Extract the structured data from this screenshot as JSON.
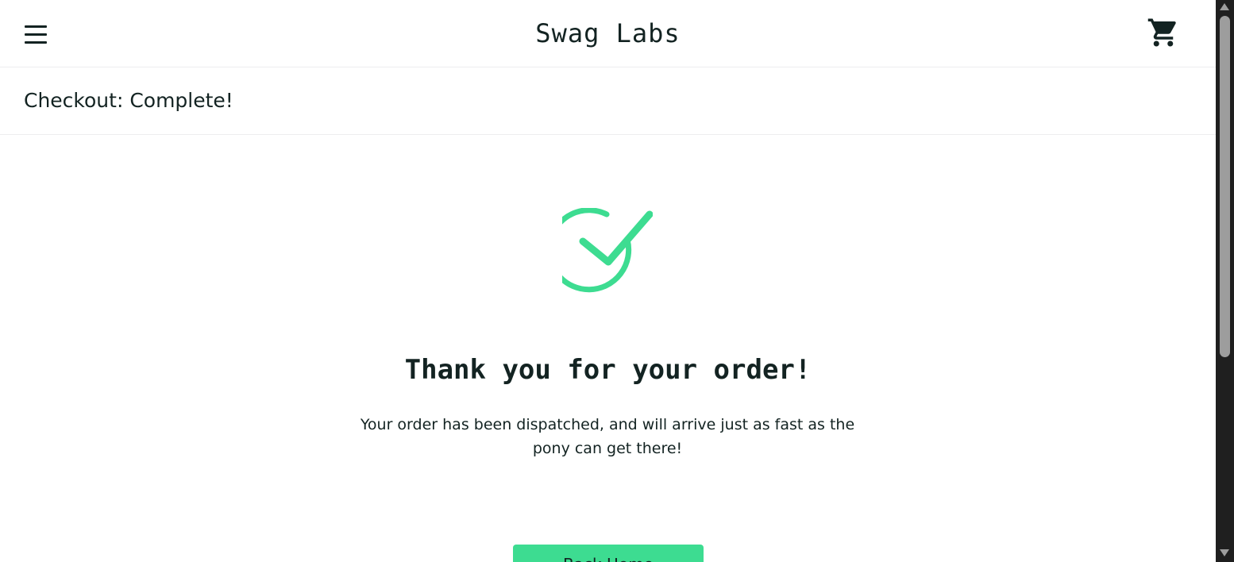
{
  "header": {
    "logo": "Swag Labs",
    "menu_icon": "hamburger-menu-icon",
    "cart_icon": "shopping-cart-icon"
  },
  "secondary_header": {
    "title": "Checkout: Complete!"
  },
  "complete": {
    "icon": "check-circle-icon",
    "heading": "Thank you for your order!",
    "message": "Your order has been dispatched, and will arrive just as fast as the pony can get there!",
    "back_home_label": "Back Home"
  },
  "colors": {
    "accent": "#3ddc91",
    "text": "#132322",
    "scrollbar_track": "#1f1f1f",
    "scrollbar_thumb": "#9d9d9d"
  }
}
